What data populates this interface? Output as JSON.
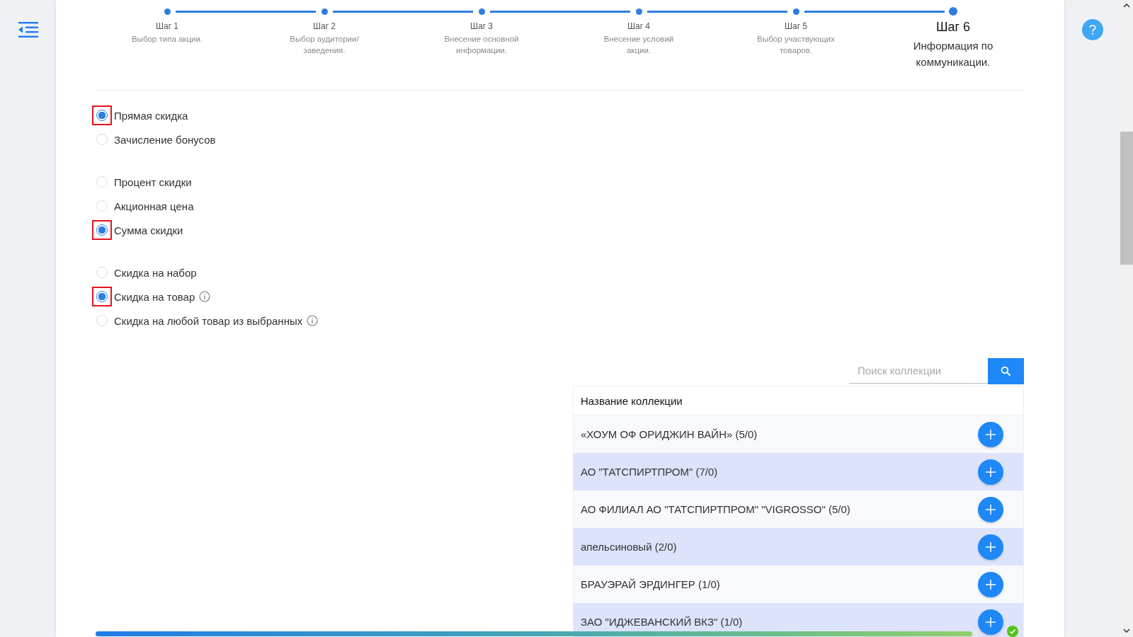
{
  "steps": [
    {
      "label": "Шаг 1",
      "description": "Выбор типа акции.",
      "current": false
    },
    {
      "label": "Шаг 2",
      "description": "Выбор аудитории/заведения.",
      "current": false
    },
    {
      "label": "Шаг 3",
      "description": "Внесение основной информации.",
      "current": false
    },
    {
      "label": "Шаг 4",
      "description": "Внесение условий акции.",
      "current": false
    },
    {
      "label": "Шаг 5",
      "description": "Выбор участвующих товаров.",
      "current": false
    },
    {
      "label": "Шаг 6",
      "description": "Информация по коммуникации.",
      "current": true
    }
  ],
  "radio_groups": [
    [
      {
        "label": "Прямая скидка",
        "selected": true,
        "info": false
      },
      {
        "label": "Зачисление бонусов",
        "selected": false,
        "info": false
      }
    ],
    [
      {
        "label": "Процент скидки",
        "selected": false,
        "info": false
      },
      {
        "label": "Акционная цена",
        "selected": false,
        "info": false
      },
      {
        "label": "Сумма скидки",
        "selected": true,
        "info": false
      }
    ],
    [
      {
        "label": "Скидка на набор",
        "selected": false,
        "info": false
      },
      {
        "label": "Скидка на товар",
        "selected": true,
        "info": true
      },
      {
        "label": "Скидка на любой товар из выбранных",
        "selected": false,
        "info": true
      }
    ]
  ],
  "search": {
    "placeholder": "Поиск коллекции"
  },
  "table": {
    "columns": [
      "Название коллекции"
    ],
    "rows": [
      {
        "name": "«ХОУМ ОФ ОРИДЖИН ВАЙН» (5/0)"
      },
      {
        "name": "АО \"ТАТСПИРТПРОМ\" (7/0)"
      },
      {
        "name": "АО ФИЛИАЛ АО \"ТАТСПИРТПРОМ\" \"VIGROSSO\" (5/0)"
      },
      {
        "name": "апельсиновый (2/0)"
      },
      {
        "name": "БРАУЭРАЙ ЭРДИНГЕР (1/0)"
      },
      {
        "name": "ЗАО \"ИДЖЕВАНСКИЙ ВКЗ\" (1/0)"
      }
    ]
  },
  "progress": {
    "level": 0.99,
    "complete": true
  }
}
